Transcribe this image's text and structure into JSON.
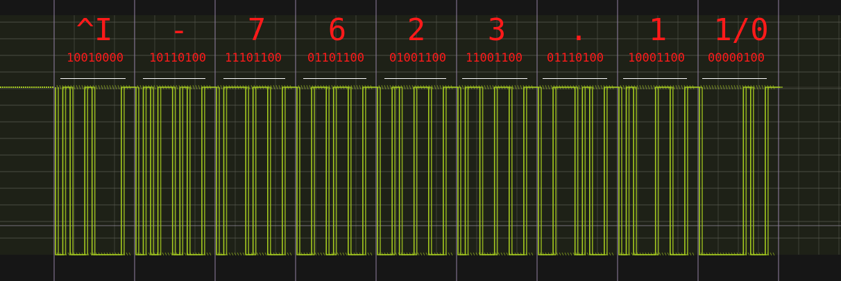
{
  "colors": {
    "background": "#161616",
    "screen": "#1e2117",
    "grid": "#5a5c52",
    "divider": "#8f7fa0",
    "trace": "#a6cc20",
    "annotation": "#ff1a1a",
    "bar": "#ffffff"
  },
  "decoded": {
    "bytes": [
      {
        "char": "^I",
        "bits": "10010000"
      },
      {
        "char": "-",
        "bits": "10110100"
      },
      {
        "char": "7",
        "bits": "11101100"
      },
      {
        "char": "6",
        "bits": "01101100"
      },
      {
        "char": "2",
        "bits": "01001100"
      },
      {
        "char": "3",
        "bits": "11001100"
      },
      {
        "char": ".",
        "bits": "01110100"
      },
      {
        "char": "1",
        "bits": "10001100"
      },
      {
        "char": "1/0",
        "bits": "00000100"
      }
    ]
  }
}
